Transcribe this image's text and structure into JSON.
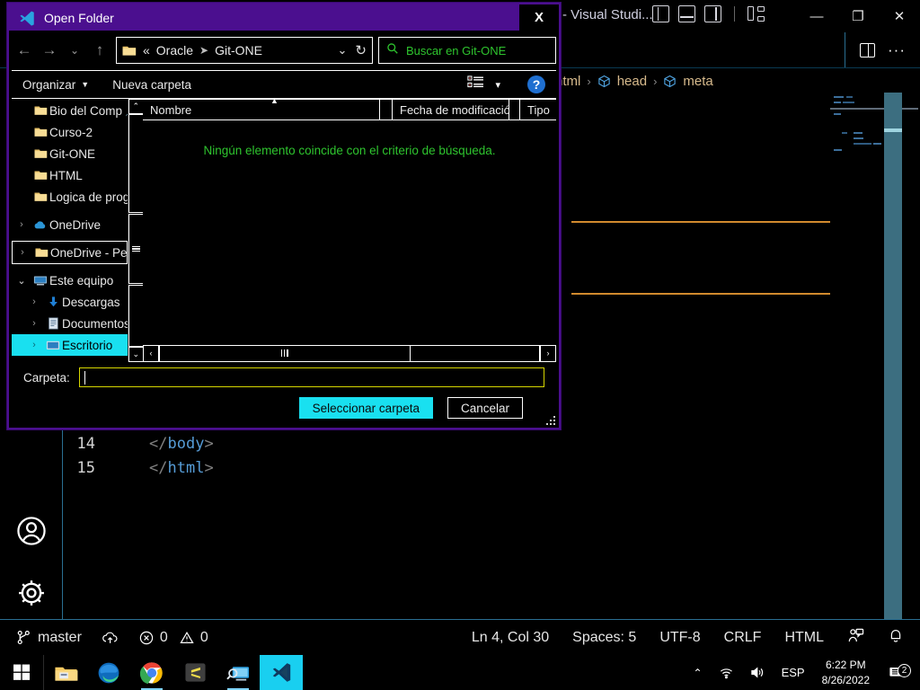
{
  "vscode": {
    "title": "- Visual Studi...",
    "breadcrumb": [
      "html",
      "head",
      "meta"
    ],
    "editor": {
      "lines": [
        {
          "number": "14",
          "text": "</body>"
        },
        {
          "number": "15",
          "text": "</html>"
        }
      ]
    },
    "activity_icons": [
      "account-icon",
      "gear-icon"
    ],
    "statusbar": {
      "branch": "master",
      "sync_icon": "cloud-upload-icon",
      "errors": "0",
      "warnings": "0",
      "position": "Ln 4, Col 30",
      "spaces": "Spaces: 5",
      "encoding": "UTF-8",
      "eol": "CRLF",
      "language": "HTML",
      "feedback_icon": "feedback-icon",
      "bell_icon": "bell-icon"
    },
    "titlebar_icons": [
      "toggle-primary-sidebar-icon",
      "toggle-panel-icon",
      "toggle-secondary-sidebar-icon",
      "customize-layout-icon"
    ],
    "window_controls": {
      "minimize": "—",
      "maximize": "❐",
      "close": "✕"
    },
    "tab_actions": {
      "split_editor": "split-editor-icon",
      "more": "···"
    }
  },
  "dialog": {
    "title": "Open Folder",
    "close_label": "X",
    "nav": {
      "back": "←",
      "forward": "→",
      "recent": "⌄",
      "up": "↑",
      "breadcrumb_prefix": "«",
      "path_parts": [
        "Oracle",
        "Git-ONE"
      ],
      "dropdown": "⌄",
      "refresh": "↻"
    },
    "search": {
      "placeholder": "Buscar en Git-ONE",
      "icon": "search-icon"
    },
    "toolbar": {
      "organize": "Organizar",
      "new_folder": "Nueva carpeta",
      "view_icon": "list-view-icon",
      "view_caret": "▾",
      "help": "?"
    },
    "tree": [
      {
        "label": "Bio del Comp",
        "icon": "folder-icon",
        "chevron": "",
        "indent": 1,
        "pinned": true,
        "state": "normal"
      },
      {
        "label": "Curso-2",
        "icon": "folder-icon",
        "chevron": "",
        "indent": 1,
        "pinned": false,
        "state": "normal"
      },
      {
        "label": "Git-ONE",
        "icon": "folder-icon",
        "chevron": "",
        "indent": 1,
        "pinned": false,
        "state": "normal"
      },
      {
        "label": "HTML",
        "icon": "folder-icon",
        "chevron": "",
        "indent": 1,
        "pinned": false,
        "state": "normal"
      },
      {
        "label": "Logica de progra",
        "icon": "folder-icon",
        "chevron": "",
        "indent": 1,
        "pinned": false,
        "state": "normal"
      },
      {
        "label": "OneDrive",
        "icon": "cloud-icon",
        "chevron": "›",
        "indent": 0,
        "pinned": false,
        "state": "normal"
      },
      {
        "label": "OneDrive - Personal",
        "icon": "folder-icon",
        "chevron": "›",
        "indent": 0,
        "pinned": false,
        "state": "outlined"
      },
      {
        "label": "Este equipo",
        "icon": "computer-icon",
        "chevron": "⌄",
        "indent": 0,
        "pinned": false,
        "state": "expanded"
      },
      {
        "label": "Descargas",
        "icon": "download-icon",
        "chevron": "›",
        "indent": 1,
        "pinned": false,
        "state": "normal"
      },
      {
        "label": "Documentos",
        "icon": "document-icon",
        "chevron": "›",
        "indent": 1,
        "pinned": false,
        "state": "normal"
      },
      {
        "label": "Escritorio",
        "icon": "desktop-icon",
        "chevron": "›",
        "indent": 1,
        "pinned": false,
        "state": "selected"
      }
    ],
    "columns": [
      "Nombre",
      "",
      "Fecha de modificación",
      "",
      "Tipo"
    ],
    "empty_message": "Ningún elemento coincide con el criterio de búsqueda.",
    "footer": {
      "field_label": "Carpeta:",
      "field_value": "",
      "select_button": "Seleccionar carpeta",
      "cancel_button": "Cancelar"
    },
    "scrollbars": {
      "up": "⌃",
      "down": "⌄",
      "left": "‹",
      "right": "›"
    }
  },
  "taskbar": {
    "start_icon": "windows-start-icon",
    "apps": [
      {
        "name": "file-explorer-icon",
        "active": false,
        "running": false
      },
      {
        "name": "microsoft-edge-icon",
        "active": false,
        "running": false
      },
      {
        "name": "google-chrome-icon",
        "active": false,
        "running": true
      },
      {
        "name": "sublime-text-icon",
        "active": false,
        "running": false
      },
      {
        "name": "remote-desktop-icon",
        "active": false,
        "running": true
      },
      {
        "name": "vscode-icon",
        "active": true,
        "running": true
      }
    ],
    "tray": {
      "overflow": "⌃",
      "network_icon": "wifi-icon",
      "volume_icon": "speaker-icon",
      "language": "ESP",
      "time": "6:22 PM",
      "date": "8/26/2022",
      "notification_count": "2"
    }
  },
  "colors": {
    "dialog_accent": "#4b0f8f",
    "selection": "#19e0f0",
    "green_text": "#2ec42e",
    "field_border": "#d6d600",
    "breadcrumb_text": "#d7ba8c",
    "error_underline": "#d18a2e"
  }
}
